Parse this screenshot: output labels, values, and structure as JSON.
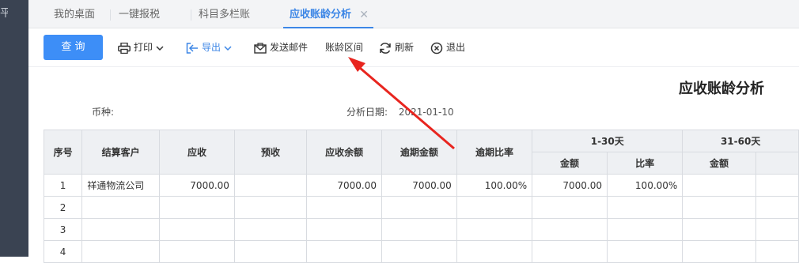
{
  "sidebar": {
    "glyph": "平"
  },
  "tabs": [
    {
      "label": "我的桌面"
    },
    {
      "label": "一键报税"
    },
    {
      "label": "科目多栏账"
    },
    {
      "label": "应收账龄分析",
      "active": true,
      "close": "✕"
    }
  ],
  "toolbar": {
    "query_label": "查 询",
    "print_label": "打印",
    "export_label": "导出",
    "email_label": "发送邮件",
    "aging_interval_label": "账龄区间",
    "refresh_label": "刷新",
    "exit_label": "退出",
    "accent_color": "#3d8ef7",
    "icons": [
      "printer-icon",
      "export-icon",
      "email-icon",
      "refresh-icon",
      "exit-icon"
    ]
  },
  "report": {
    "title": "应收账龄分析",
    "currency_label": "币种:",
    "currency_value": "",
    "date_label": "分析日期:",
    "date_value": "2021-01-10"
  },
  "table": {
    "headers": {
      "index": "序号",
      "customer": "结算客户",
      "receivable": "应收",
      "advance": "预收",
      "balance": "应收余额",
      "overdue_amount": "逾期金额",
      "overdue_ratio": "逾期比率",
      "group1": "1-30天",
      "group2": "31-60天",
      "amount": "金额",
      "ratio": "比率"
    },
    "rows": [
      {
        "index": "1",
        "customer": "祥通物流公司",
        "receivable": "7000.00",
        "advance": "",
        "balance": "7000.00",
        "overdue_amount": "7000.00",
        "overdue_ratio": "100.00%",
        "g1_amount": "7000.00",
        "g1_ratio": "100.00%",
        "g2_amount": ""
      },
      {
        "index": "2"
      },
      {
        "index": "3"
      },
      {
        "index": "4"
      }
    ]
  }
}
